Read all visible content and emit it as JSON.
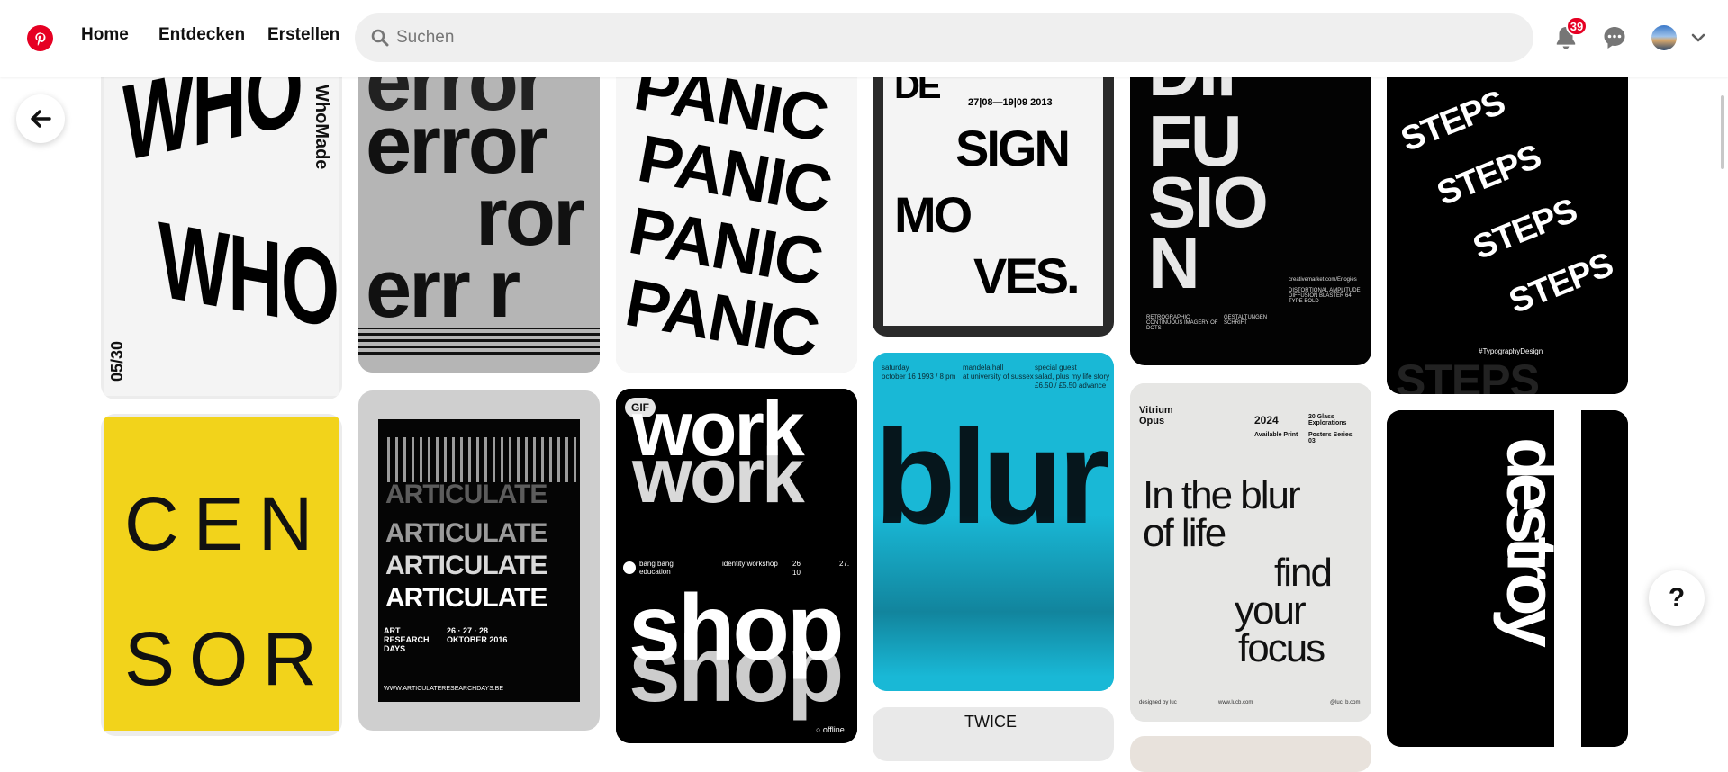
{
  "header": {
    "nav": [
      "Home",
      "Entdecken",
      "Erstellen"
    ],
    "search_placeholder": "Suchen",
    "notification_count": "39"
  },
  "icons": {
    "logo": "pinterest-logo",
    "search": "search-icon",
    "notifications": "bell-icon",
    "messages": "chat-bubble-icon",
    "account_menu": "chevron-down-icon",
    "back": "arrow-left-icon",
    "help": "question-mark-icon"
  },
  "help_label": "?",
  "brand_color": "#e60023",
  "pins": {
    "who": {
      "big": "WHO",
      "side": "WhoMade",
      "num": "05/30"
    },
    "error": {
      "lines": [
        "error",
        "error",
        "ror",
        "err r"
      ]
    },
    "panic": {
      "lines": [
        "PANIC",
        "PANIC",
        "PANIC",
        "PANIC"
      ]
    },
    "design": {
      "date": "27|08—19|09  2013",
      "line1": "DE",
      "line2": "SIGN",
      "line3": "MO",
      "line4": "VES."
    },
    "diffusion": {
      "lines": [
        "DIF",
        "FU",
        "SIO",
        "N"
      ],
      "url": "creativemarket.com/Erlogies",
      "caption1": "RETROGRAPHIC CONTINUOUS IMAGERY OF DOTS",
      "caption2": "GESTALTUNGEN SCHRIFT",
      "caption3": "DISTORTIONAL AMPLITUDE DIFFUSION BLASTER 64 TYPE BOLD"
    },
    "steps": {
      "word": "STEPS",
      "tag": "#TypographyDesign"
    },
    "censor": {
      "top": "CEN",
      "bottom": "SOR"
    },
    "articulate": {
      "word": "ARTICULATE",
      "left": "ART RESEARCH DAYS",
      "dates": "26 · 27 · 28 OKTOBER 2016",
      "url": "WWW.ARTICULATERESEARCHDAYS.BE"
    },
    "workshop": {
      "gif_label": "GIF",
      "word1": "work",
      "word2": "shop",
      "info1": "bang bang education",
      "info2": "identity workshop",
      "info3a": "26",
      "info3b": "27.",
      "info3c": "10",
      "foot": "○ offline"
    },
    "blur": {
      "word": "blur",
      "c1a": "saturday",
      "c1b": "october 16 1993 / 8 pm",
      "c2a": "mandela hall",
      "c2b": "at university of sussex",
      "c3a": "special guest",
      "c3b": "salad, plus my life story",
      "c3c": "£6.50 / £5.50 advance"
    },
    "focus": {
      "brand": "Vitrium Opus",
      "year": "2024",
      "series": "20 Glass Explorations",
      "available": "Available Print",
      "poster": "Posters Series 03",
      "line1": "In the blur",
      "line2": "of life",
      "line3": "find",
      "line4": "your",
      "line5": "focus",
      "credit": "designed by luc",
      "site": "www.lucb.com",
      "handle": "@luc_b.com"
    },
    "destroy": {
      "word": "destroy"
    },
    "twice": {
      "word": "TWICE"
    }
  }
}
